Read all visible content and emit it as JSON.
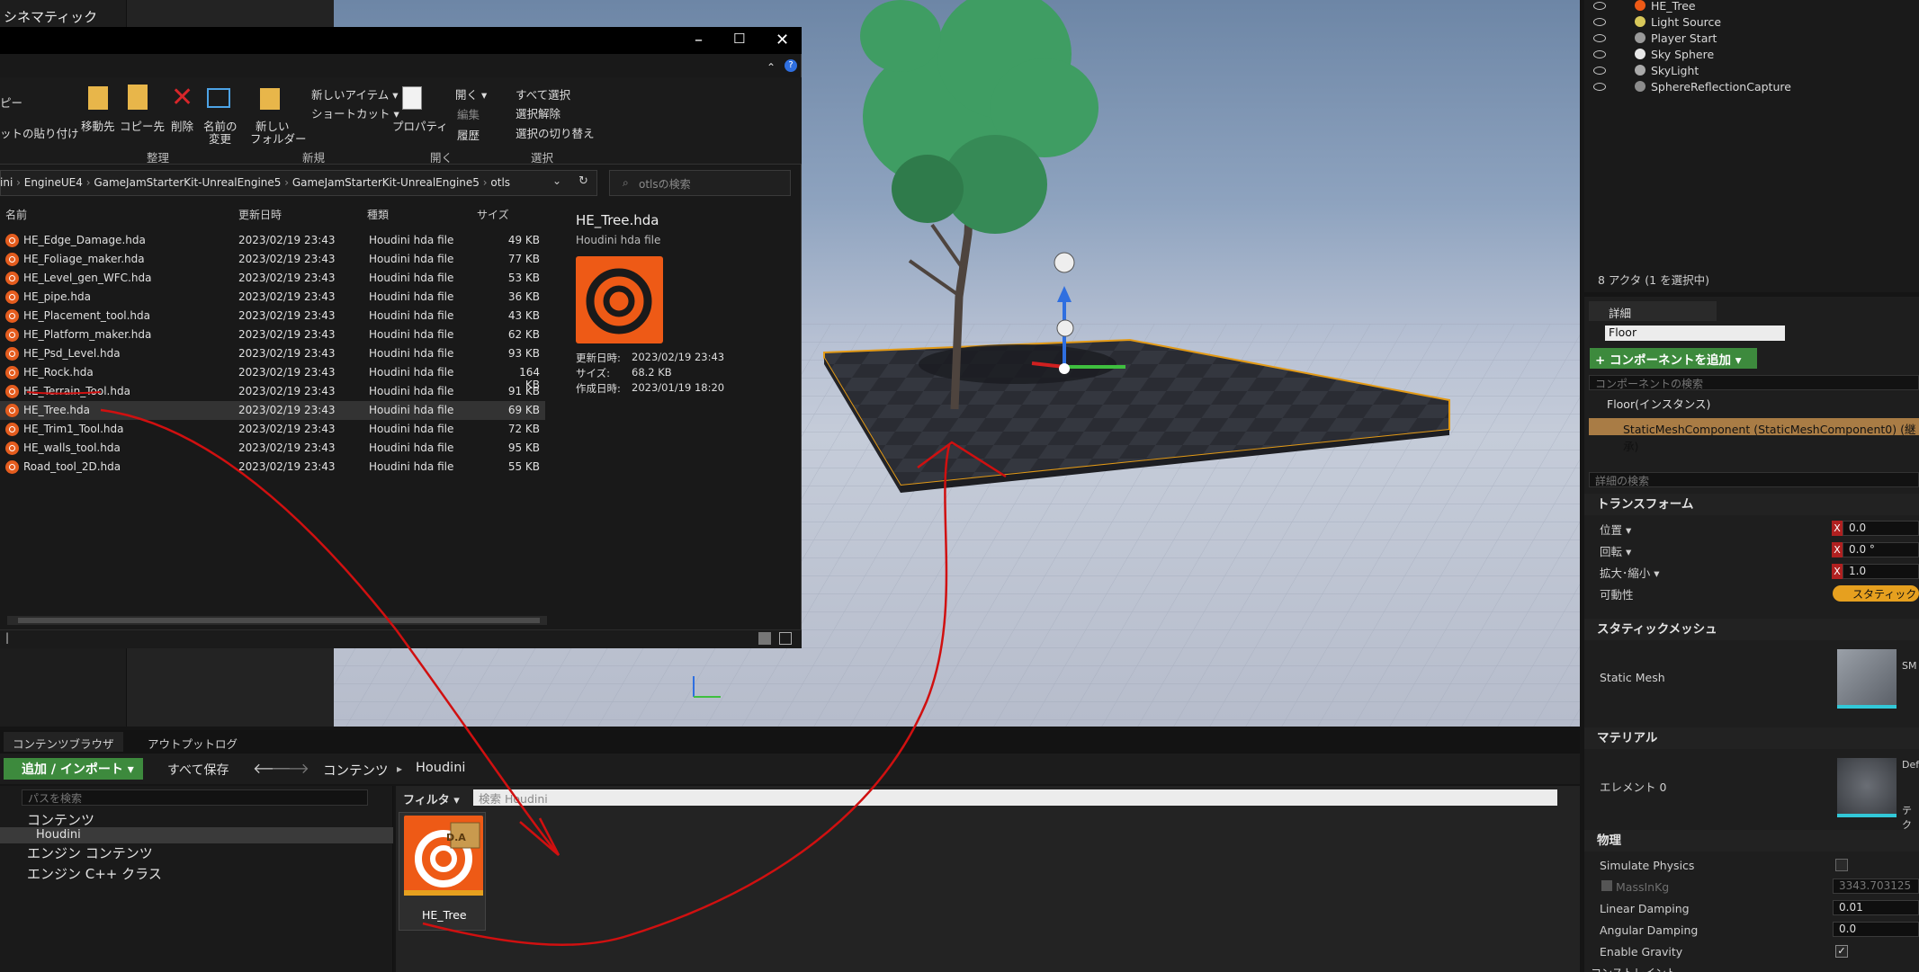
{
  "left_panel": {
    "cinematic_label": "シネマティック"
  },
  "explorer": {
    "ribbon": {
      "move_to": "移動先",
      "copy_to": "コピー先",
      "delete": "削除",
      "rename_l1": "名前の",
      "rename_l2": "変更",
      "new_folder_l1": "新しい",
      "new_folder_l2": "フォルダー",
      "new_item": "新しいアイテム ▾",
      "shortcut": "ショートカット ▾",
      "properties": "プロパティ",
      "open": "開く ▾",
      "edit": "編集",
      "history": "履歴",
      "select_all": "すべて選択",
      "select_none": "選択解除",
      "invert": "選択の切り替え",
      "copy_partial": "ピー",
      "paste_shortcut": "ットの貼り付け",
      "groups": {
        "organize": "整理",
        "new": "新規",
        "open": "開く",
        "select": "選択"
      }
    },
    "address": {
      "crumbs": [
        "ini",
        "EngineUE4",
        "GameJamStarterKit-UnrealEngine5",
        "GameJamStarterKit-UnrealEngine5",
        "otls"
      ]
    },
    "search_placeholder": "otlsの検索",
    "columns": {
      "name": "名前",
      "date": "更新日時",
      "type": "種類",
      "size": "サイズ"
    },
    "files": [
      {
        "name": "HE_Edge_Damage.hda",
        "date": "2023/02/19 23:43",
        "type": "Houdini hda file",
        "size": "49 KB"
      },
      {
        "name": "HE_Foliage_maker.hda",
        "date": "2023/02/19 23:43",
        "type": "Houdini hda file",
        "size": "77 KB"
      },
      {
        "name": "HE_Level_gen_WFC.hda",
        "date": "2023/02/19 23:43",
        "type": "Houdini hda file",
        "size": "53 KB"
      },
      {
        "name": "HE_pipe.hda",
        "date": "2023/02/19 23:43",
        "type": "Houdini hda file",
        "size": "36 KB"
      },
      {
        "name": "HE_Placement_tool.hda",
        "date": "2023/02/19 23:43",
        "type": "Houdini hda file",
        "size": "43 KB"
      },
      {
        "name": "HE_Platform_maker.hda",
        "date": "2023/02/19 23:43",
        "type": "Houdini hda file",
        "size": "62 KB"
      },
      {
        "name": "HE_Psd_Level.hda",
        "date": "2023/02/19 23:43",
        "type": "Houdini hda file",
        "size": "93 KB"
      },
      {
        "name": "HE_Rock.hda",
        "date": "2023/02/19 23:43",
        "type": "Houdini hda file",
        "size": "164 KB"
      },
      {
        "name": "HE_Terrain_Tool.hda",
        "date": "2023/02/19 23:43",
        "type": "Houdini hda file",
        "size": "91 KB"
      },
      {
        "name": "HE_Tree.hda",
        "date": "2023/02/19 23:43",
        "type": "Houdini hda file",
        "size": "69 KB"
      },
      {
        "name": "HE_Trim1_Tool.hda",
        "date": "2023/02/19 23:43",
        "type": "Houdini hda file",
        "size": "72 KB"
      },
      {
        "name": "HE_walls_tool.hda",
        "date": "2023/02/19 23:43",
        "type": "Houdini hda file",
        "size": "95 KB"
      },
      {
        "name": "Road_tool_2D.hda",
        "date": "2023/02/19 23:43",
        "type": "Houdini hda file",
        "size": "55 KB"
      }
    ],
    "preview": {
      "title": "HE_Tree.hda",
      "subtitle": "Houdini hda file",
      "modified_label": "更新日時:",
      "modified": "2023/02/19 23:43",
      "size_label": "サイズ:",
      "size": "68.2 KB",
      "created_label": "作成日時:",
      "created": "2023/01/19 18:20"
    },
    "status": "|"
  },
  "outliner": {
    "items": [
      {
        "label": "HE_Tree",
        "icon": "houdini-icon"
      },
      {
        "label": "Light Source",
        "icon": "light-icon"
      },
      {
        "label": "Player Start",
        "icon": "player-start-icon"
      },
      {
        "label": "Sky Sphere",
        "icon": "sphere-icon"
      },
      {
        "label": "SkyLight",
        "icon": "skylight-icon"
      },
      {
        "label": "SphereReflectionCapture",
        "icon": "reflection-icon"
      }
    ],
    "actor_count": "8 アクタ (1 を選択中)"
  },
  "details": {
    "tab": "詳細",
    "object_name": "Floor",
    "add_component": "+ コンポーネントを追加 ▾",
    "component_search": "コンポーネントの検索",
    "instance": "Floor(インスタンス)",
    "component": "StaticMeshComponent (StaticMeshComponent0) (継承)",
    "details_search": "詳細の検索",
    "transform": {
      "header": "トランスフォーム",
      "location": "位置 ▾",
      "rotation": "回転 ▾",
      "scale": "拡大･縮小 ▾",
      "mobility": "可動性",
      "loc_x": "0.0",
      "rot_x": "0.0 °",
      "scale_x": "1.0",
      "mobility_value": "スタティック"
    },
    "static_mesh": {
      "header": "スタティックメッシュ",
      "label": "Static Mesh",
      "value": "SM"
    },
    "materials": {
      "header": "マテリアル",
      "element0": "エレメント 0",
      "value": "Def",
      "value2": "テク"
    },
    "physics": {
      "header": "物理",
      "simulate": "Simulate Physics",
      "mass": "MassInKg",
      "mass_value": "3343.703125",
      "linear": "Linear Damping",
      "linear_value": "0.01",
      "angular": "Angular Damping",
      "angular_value": "0.0",
      "gravity": "Enable Gravity"
    },
    "constraints": "コンストレイント"
  },
  "content_browser": {
    "tabs": [
      "コンテンツブラウザ",
      "アウトプットログ"
    ],
    "add_import": "追加 / インポート ▾",
    "save_all": "すべて保存",
    "path": [
      "コンテンツ",
      "Houdini"
    ],
    "path_search": "パスを検索",
    "filter": "フィルタ ▾",
    "asset_search": "検索 Houdini",
    "tree": [
      {
        "label": "コンテンツ"
      },
      {
        "label": "Houdini"
      },
      {
        "label": "エンジン コンテンツ"
      },
      {
        "label": "エンジン C++ クラス"
      }
    ],
    "asset": {
      "name": "HE_Tree",
      "badge": "D.A"
    }
  },
  "colors": {
    "houdini_orange": "#ee5a16",
    "accent_green": "#3d8a3d",
    "annotation_red": "#d01010",
    "selection_orange": "#e6a01f"
  }
}
